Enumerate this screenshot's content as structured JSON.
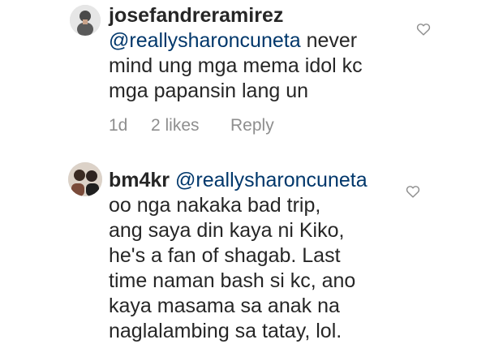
{
  "comments": [
    {
      "username": "josefandreramirez",
      "mention": "@reallysharoncuneta",
      "lines": [
        " never",
        "mind ung mga mema idol kc",
        "mga papansin lang un"
      ],
      "meta": {
        "time": "1d",
        "likes": "2 likes",
        "reply": "Reply"
      },
      "like_icon": "heart-outline-icon"
    },
    {
      "username": "bm4kr",
      "mention": "@reallysharoncuneta",
      "lines": [
        "oo nga nakaka bad trip,",
        "ang saya din kaya ni Kiko,",
        "he's a fan of shagab. Last",
        "time naman bash si kc, ano",
        "kaya masama sa anak na",
        "naglalambing sa tatay, lol."
      ],
      "like_icon": "heart-outline-icon"
    }
  ],
  "colors": {
    "text": "#262626",
    "mention": "#00376b",
    "meta": "#8e8e8e"
  }
}
